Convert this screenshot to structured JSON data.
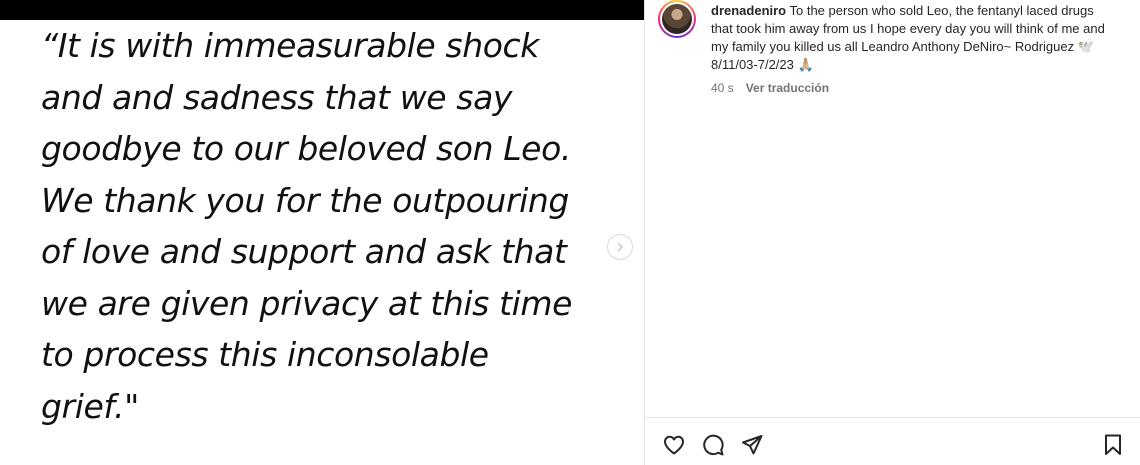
{
  "post": {
    "quote_lines": [
      "“It is with immeasurable shock",
      "and and sadness that we say",
      "goodbye to our beloved son Leo.",
      "We thank you for the outpouring",
      "of love and support and ask that",
      "we are given privacy at this time",
      "to process this inconsolable",
      "grief.\""
    ],
    "next_icon": "chevron-right-icon"
  },
  "comment": {
    "username": "drenadeniro",
    "text": " To the person who sold Leo, the fentanyl laced drugs that took him away from us I hope every day you will think of me and my family you killed us all Leandro Anthony DeNiro~ Rodriguez 🕊️ 8/11/03-7/2/23 🙏🏼",
    "time": "40 s",
    "translate_label": "Ver traducción"
  },
  "actions": {
    "like_icon": "heart-icon",
    "comment_icon": "comment-icon",
    "share_icon": "send-icon",
    "save_icon": "bookmark-icon"
  },
  "colors": {
    "text": "#262626",
    "muted": "#737373",
    "divider": "#e3e3e3"
  }
}
